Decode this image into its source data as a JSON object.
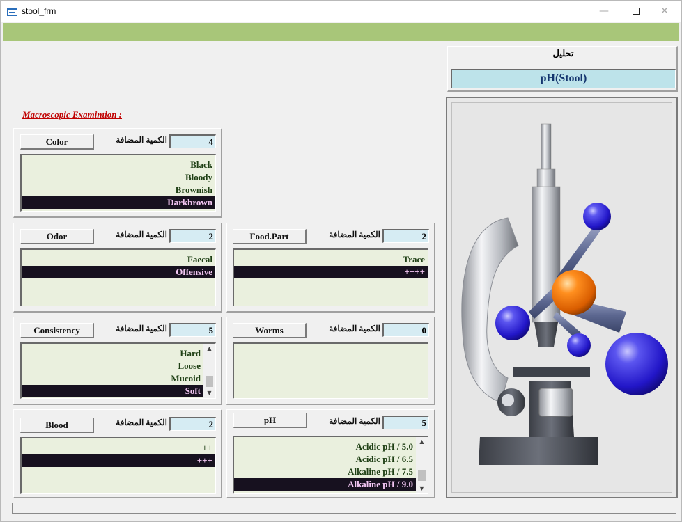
{
  "window": {
    "title": "stool_frm",
    "minimize": "—",
    "close": "✕"
  },
  "section_title": "Macroscopic Examintion :",
  "analysis": {
    "label": "تحليل",
    "value": "pH(Stool)"
  },
  "qty_label": "الكمية المضافة",
  "fields": {
    "color": {
      "button": "Color",
      "qty": "4",
      "items": [
        "Black",
        "Bloody",
        "Brownish",
        "Darkbrown"
      ],
      "selected": "Darkbrown"
    },
    "odor": {
      "button": "Odor",
      "qty": "2",
      "items": [
        "Faecal",
        "Offensive"
      ],
      "selected": "Offensive"
    },
    "food_part": {
      "button": "Food.Part",
      "qty": "2",
      "items": [
        "Trace",
        "++++"
      ],
      "selected": "++++"
    },
    "consistency": {
      "button": "Consistency",
      "qty": "5",
      "items": [
        "Hard",
        "Loose",
        "Mucoid",
        "Soft"
      ],
      "selected": "Soft"
    },
    "worms": {
      "button": "Worms",
      "qty": "0",
      "items": [],
      "selected": ""
    },
    "blood": {
      "button": "Blood",
      "qty": "2",
      "items": [
        "++",
        "+++"
      ],
      "selected": "+++"
    },
    "ph": {
      "button": "pH",
      "qty": "5",
      "items": [
        "Acidic pH / 5.0",
        "Acidic pH / 6.5",
        "Alkaline pH / 7.5",
        "Alkaline pH / 9.0"
      ],
      "selected": "Alkaline pH / 9.0"
    }
  },
  "colors": {
    "title_green": "#a8c679",
    "list_bg": "#eaf0de",
    "list_text": "#1e3f14",
    "selected_bg": "#17111f",
    "selected_text": "#f2c6f2",
    "qty_bg": "#d6ecf3",
    "analysis_bg": "#bde3ea",
    "heading_red": "#c00000"
  },
  "image": {
    "icon": "microscope-molecule-illustration"
  }
}
